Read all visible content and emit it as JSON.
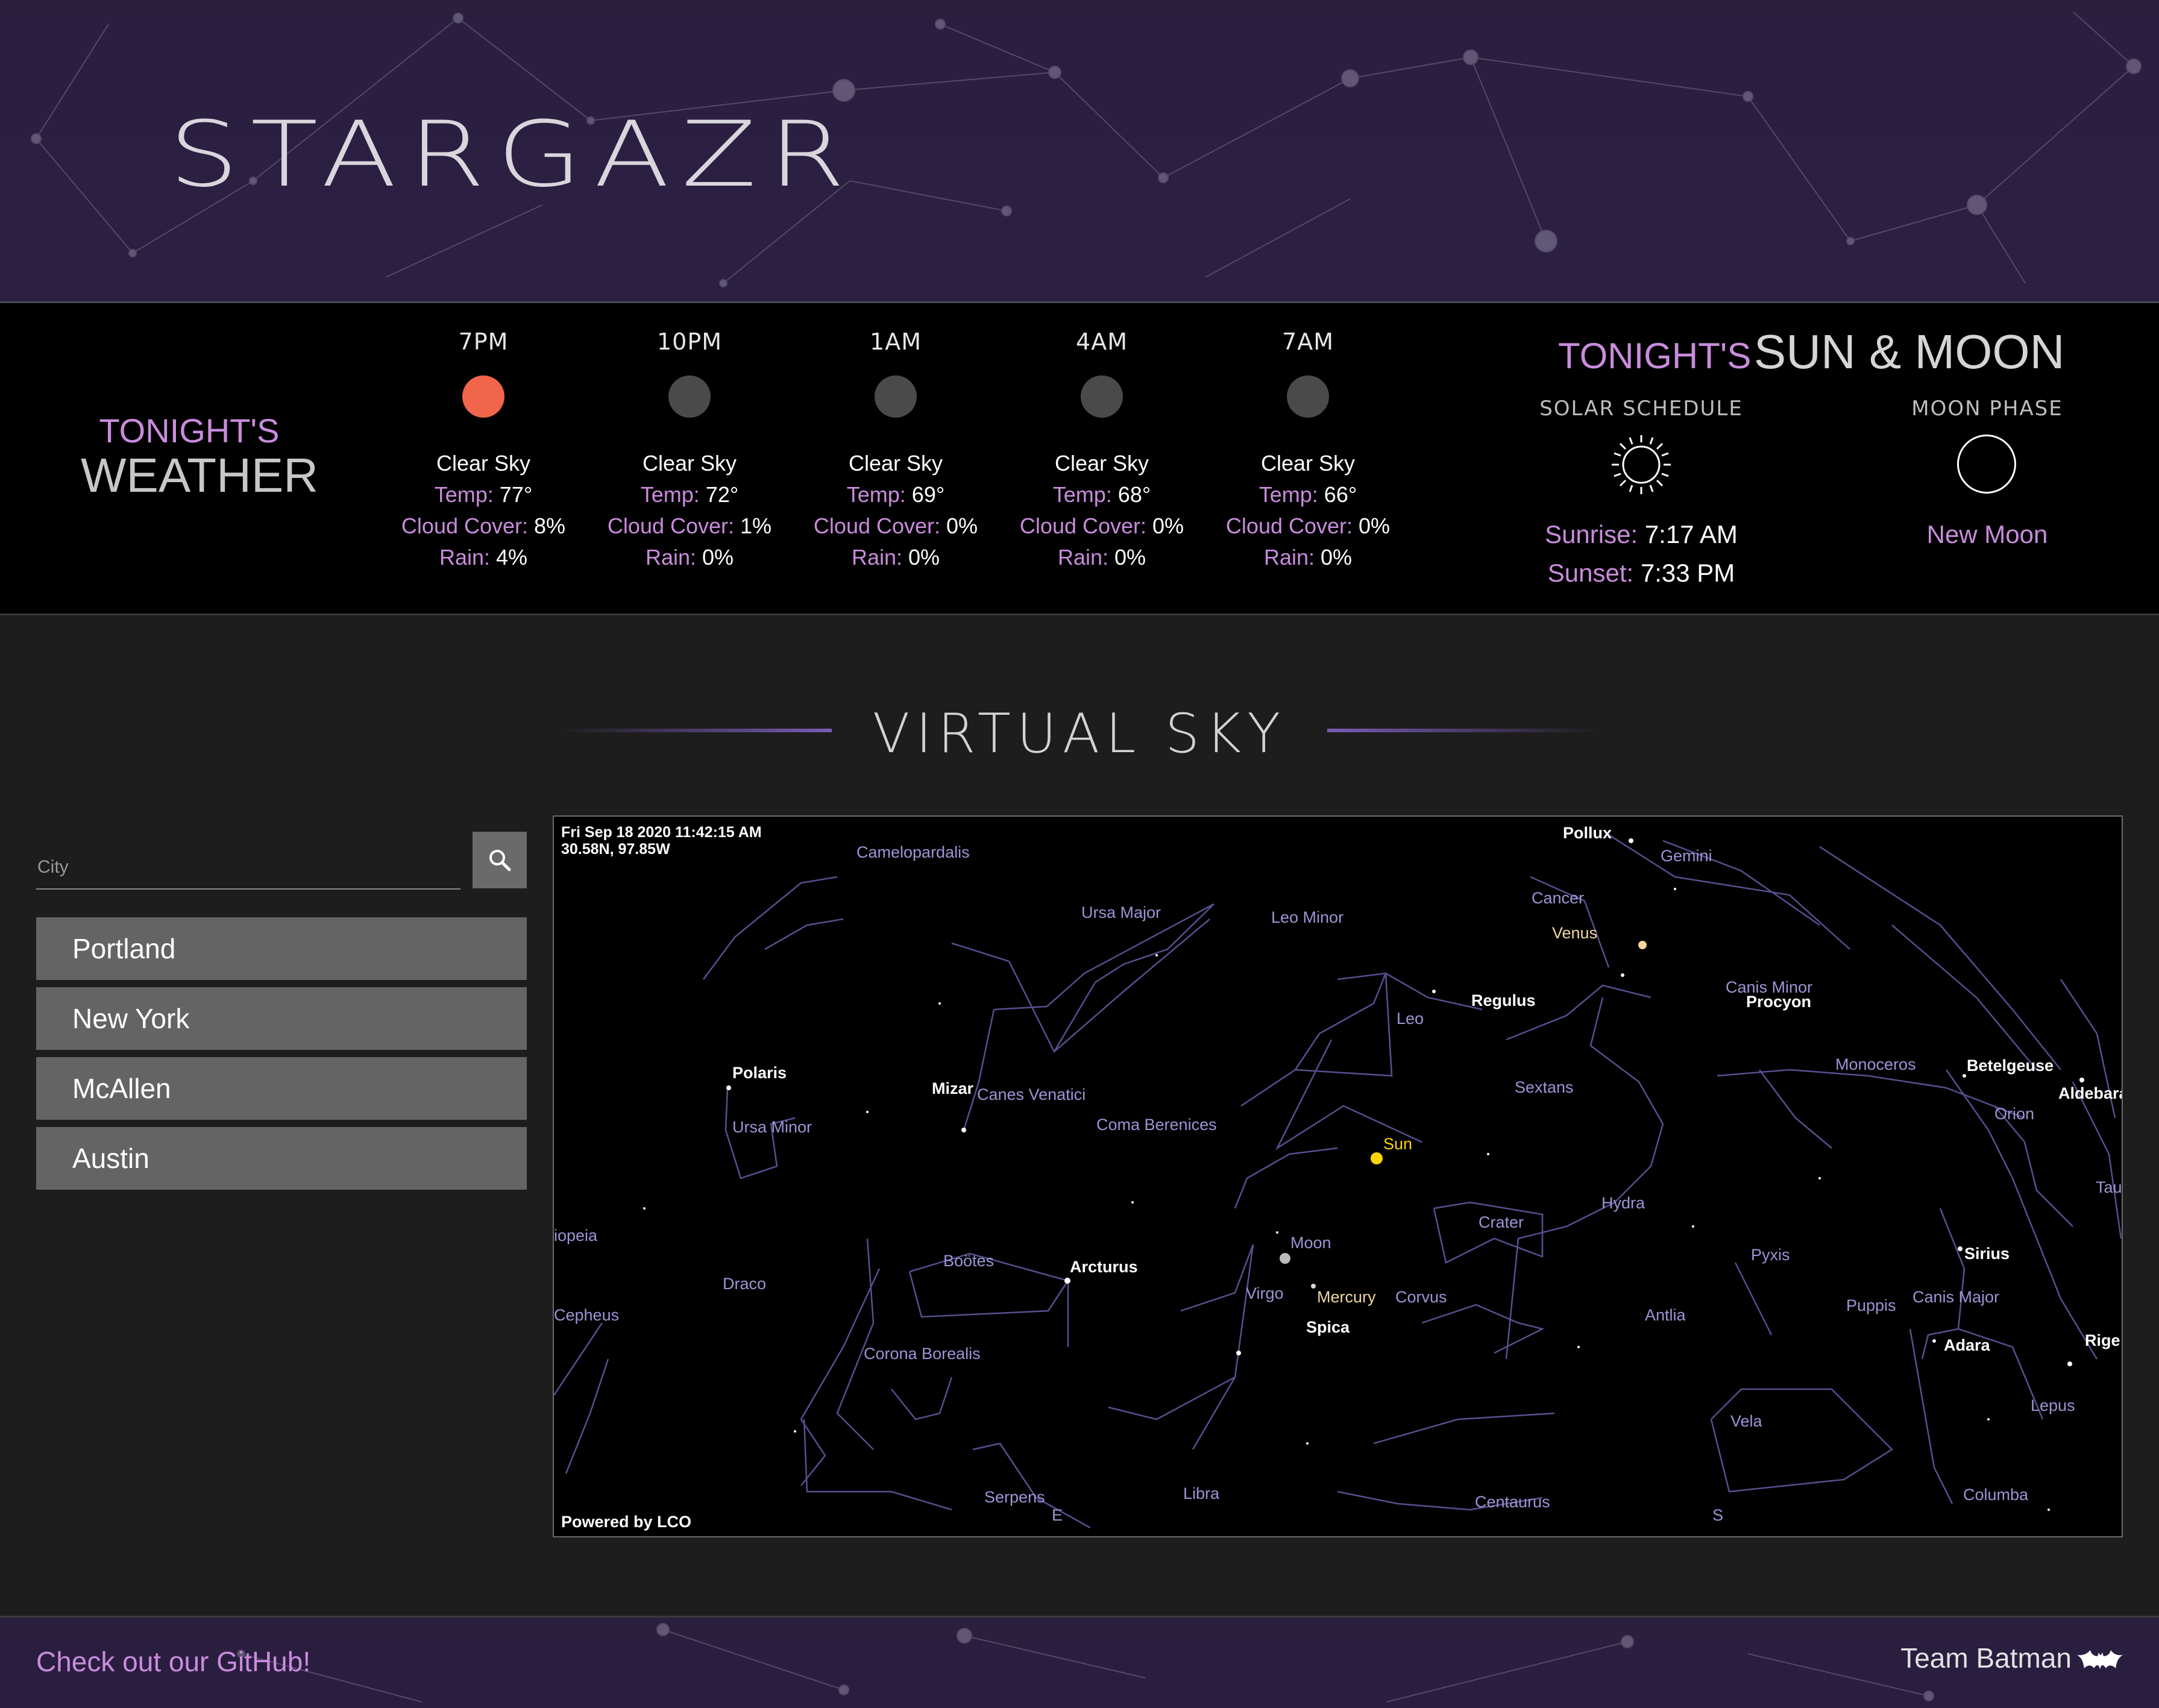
{
  "app": {
    "title": "STARGAZR"
  },
  "weather": {
    "heading_small": "TONIGHT'S",
    "heading_big": "WEATHER",
    "labels": {
      "temp": "Temp:",
      "cloud": "Cloud Cover:",
      "rain": "Rain:"
    },
    "forecast": [
      {
        "time": "7PM",
        "condition": "Clear Sky",
        "temp": "77°",
        "cloud": "8%",
        "rain": "4%",
        "dot_color": "#f0654b"
      },
      {
        "time": "10PM",
        "condition": "Clear Sky",
        "temp": "72°",
        "cloud": "1%",
        "rain": "0%",
        "dot_color": "#4a4a4a"
      },
      {
        "time": "1AM",
        "condition": "Clear Sky",
        "temp": "69°",
        "cloud": "0%",
        "rain": "0%",
        "dot_color": "#4a4a4a"
      },
      {
        "time": "4AM",
        "condition": "Clear Sky",
        "temp": "68°",
        "cloud": "0%",
        "rain": "0%",
        "dot_color": "#4a4a4a"
      },
      {
        "time": "7AM",
        "condition": "Clear Sky",
        "temp": "66°",
        "cloud": "0%",
        "rain": "0%",
        "dot_color": "#4a4a4a"
      }
    ]
  },
  "sun_moon": {
    "heading_small": "TONIGHT'S",
    "heading_big": "SUN & MOON",
    "solar_heading": "SOLAR SCHEDULE",
    "moon_heading": "MOON PHASE",
    "sunrise_label": "Sunrise:",
    "sunrise": "7:17 AM",
    "sunset_label": "Sunset:",
    "sunset": "7:33 PM",
    "moon_phase": "New Moon"
  },
  "virtual_sky": {
    "title": "VIRTUAL SKY",
    "datetime": "Fri Sep 18 2020 11:42:15 AM",
    "coords": "30.58N, 97.85W",
    "credit": "Powered by LCO",
    "labels": {
      "camelopardalis": "Camelopardalis",
      "pollux": "Pollux",
      "gemini": "Gemini",
      "ursa_major": "Ursa Major",
      "leo_minor": "Leo Minor",
      "cancer": "Cancer",
      "venus": "Venus",
      "canis_minor": "Canis Minor",
      "procyon": "Procyon",
      "regulus": "Regulus",
      "leo": "Leo",
      "polaris": "Polaris",
      "mizar": "Mizar",
      "canes_venatici": "Canes Venatici",
      "sextans": "Sextans",
      "monoceros": "Monoceros",
      "betelgeuse": "Betelgeuse",
      "aldebaran": "Aldebara",
      "ursa_minor": "Ursa Minor",
      "coma_berenices": "Coma Berenices",
      "orion": "Orion",
      "sun": "Sun",
      "taurus": "Tauru",
      "crater": "Crater",
      "hydra": "Hydra",
      "cassiopeia": "iopeia",
      "moon": "Moon",
      "bootes": "Boötes",
      "arcturus": "Arcturus",
      "pyxis": "Pyxis",
      "sirius": "Sirius",
      "draco": "Draco",
      "virgo": "Virgo",
      "mercury": "Mercury",
      "corvus": "Corvus",
      "canis_major": "Canis Major",
      "puppis": "Puppis",
      "cepheus": "Cepheus",
      "antlia": "Antlia",
      "spica": "Spica",
      "adara": "Adara",
      "rigel": "Rige",
      "corona_borealis": "Corona Borealis",
      "lepus": "Lepus",
      "vela": "Vela",
      "serpens": "Serpens",
      "east": "E",
      "libra": "Libra",
      "centaurus": "Centaurus",
      "south": "S",
      "columba": "Columba"
    }
  },
  "search": {
    "placeholder": "City",
    "value": "",
    "cities": [
      "Portland",
      "New York",
      "McAllen",
      "Austin"
    ]
  },
  "footer": {
    "github_link": "Check out our GitHub!",
    "team": "Team Batman"
  },
  "colors": {
    "accent": "#c98cdc",
    "header_bg": "#2a1f3f",
    "band_bg": "#000000",
    "page_bg": "#1d1d1d",
    "button_bg": "#646464",
    "constellation_line": "#6f6aa8"
  }
}
